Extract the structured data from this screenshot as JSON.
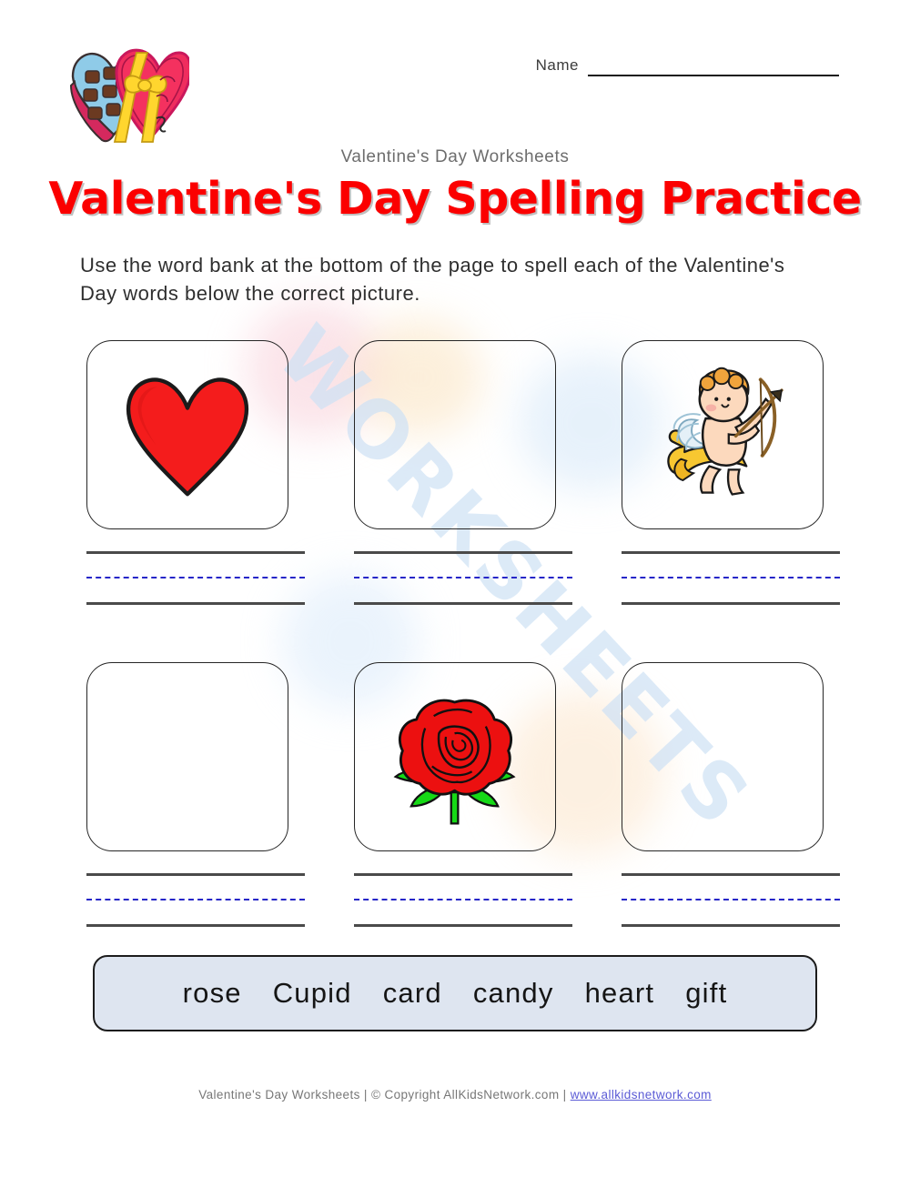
{
  "header": {
    "logo_icon": "heart-chocolate-box-icon",
    "name_label": "Name",
    "subtitle": "Valentine's Day Worksheets",
    "title": "Valentine's Day Spelling Practice"
  },
  "instructions": "Use the word bank at the bottom of the page to spell each of the Valentine's Day words below the correct picture.",
  "grid": {
    "rows": [
      {
        "cells": [
          {
            "picture": "heart-icon",
            "has_picture": true
          },
          {
            "picture": "",
            "has_picture": false
          },
          {
            "picture": "cupid-icon",
            "has_picture": true
          }
        ]
      },
      {
        "cells": [
          {
            "picture": "",
            "has_picture": false
          },
          {
            "picture": "rose-icon",
            "has_picture": true
          },
          {
            "picture": "",
            "has_picture": false
          }
        ]
      }
    ]
  },
  "word_bank": {
    "words": [
      "rose",
      "Cupid",
      "card",
      "candy",
      "heart",
      "gift"
    ]
  },
  "footer": {
    "text": "Valentine's Day Worksheets | © Copyright AllKidsNetwork.com | ",
    "url": "www.allkidsnetwork.com"
  },
  "watermark": {
    "text": "WORKSHEETS"
  },
  "colors": {
    "title_red": "#fb0000",
    "heart_red": "#f41c1c",
    "word_bank_bg": "#dee5f0",
    "mid_line_blue": "#2626c8",
    "link_blue": "#5b5bd6"
  }
}
